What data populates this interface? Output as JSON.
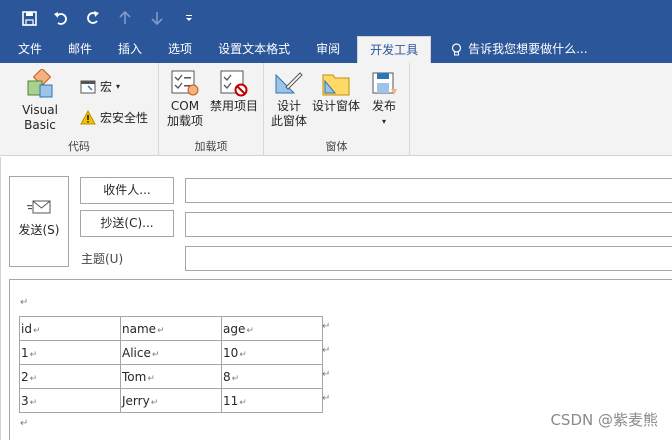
{
  "tabs": [
    "文件",
    "邮件",
    "插入",
    "选项",
    "设置文本格式",
    "审阅",
    "开发工具"
  ],
  "tell_me": "告诉我您想要做什么...",
  "ribbon": {
    "groups": {
      "code": "代码",
      "addins": "加载项",
      "forms": "窗体"
    },
    "visual_basic": "Visual Basic",
    "macro": "宏",
    "macro_security": "宏安全性",
    "com_line1": "COM",
    "com_line2": "加载项",
    "disabled_items": "禁用项目",
    "design_line1": "设计",
    "design_line2": "此窗体",
    "design_form": "设计窗体",
    "publish": "发布"
  },
  "compose": {
    "send": "发送(S)",
    "to": "收件人...",
    "cc": "抄送(C)...",
    "subject_label": "主题(U)",
    "to_value": "",
    "cc_value": "",
    "subject_value": ""
  },
  "table": {
    "rows": [
      [
        "id",
        "name",
        "age"
      ],
      [
        "1",
        "Alice",
        "10"
      ],
      [
        "2",
        "Tom",
        "8"
      ],
      [
        "3",
        "Jerry",
        "11"
      ]
    ]
  },
  "watermark": "CSDN @紫麦熊",
  "colors": {
    "title_bar": "#2b579a",
    "ribbon_bg": "#f3f3f3"
  }
}
